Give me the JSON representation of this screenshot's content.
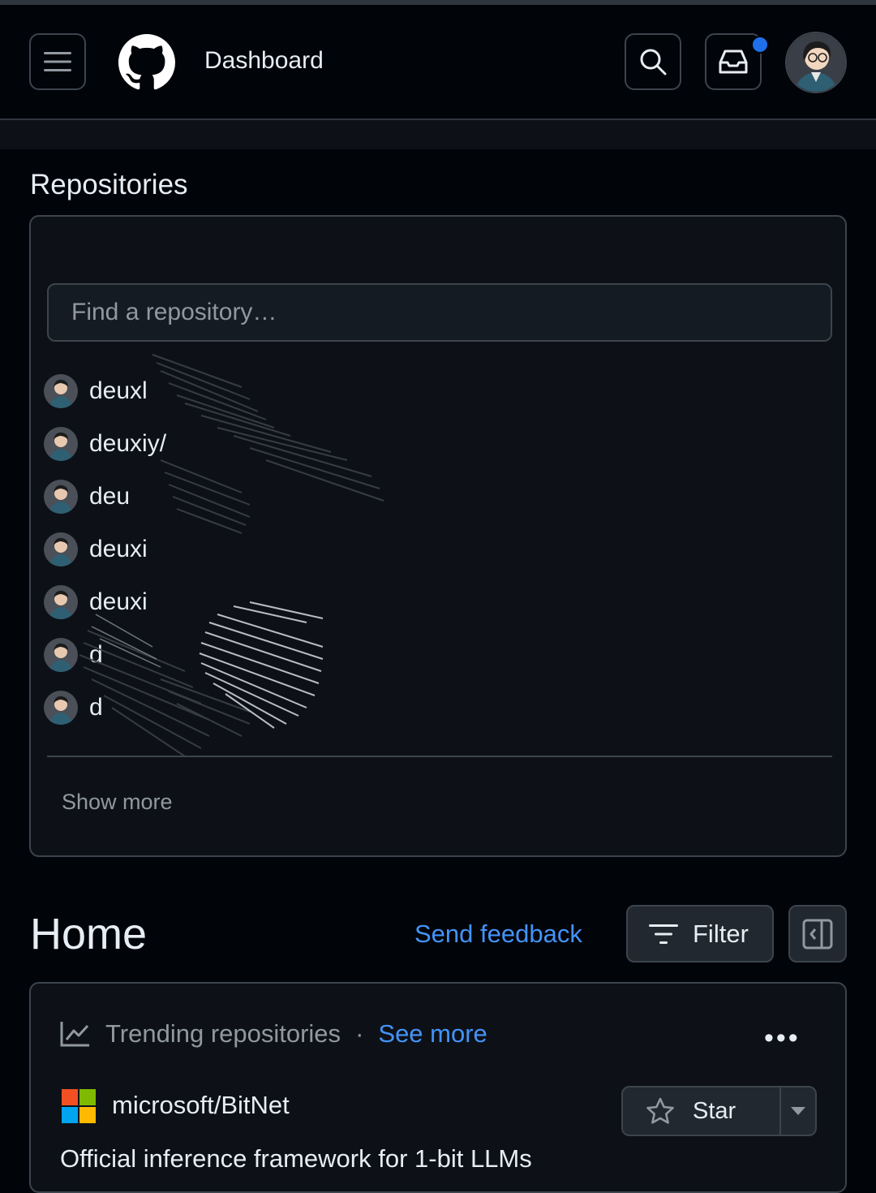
{
  "header": {
    "title": "Dashboard",
    "notification_dot_color": "#1f6feb",
    "icons": [
      "hamburger-icon",
      "github-logo",
      "search-icon",
      "inbox-icon",
      "avatar"
    ]
  },
  "repositories": {
    "heading": "Repositories",
    "search_placeholder": "Find a repository…",
    "items": [
      {
        "name": "deuxl"
      },
      {
        "name": "deuxiy/"
      },
      {
        "name": "deu"
      },
      {
        "name": "deuxi"
      },
      {
        "name": "deuxi"
      },
      {
        "name": "d"
      },
      {
        "name": "d"
      }
    ],
    "show_more": "Show more"
  },
  "home": {
    "title": "Home",
    "send_feedback": "Send feedback",
    "filter_label": "Filter"
  },
  "trending": {
    "label": "Trending repositories",
    "separator": "·",
    "see_more": "See more",
    "repo": {
      "full_name": "microsoft/BitNet",
      "description": "Official inference framework for 1-bit LLMs",
      "star_label": "Star"
    }
  },
  "colors": {
    "background": "#010409",
    "card": "#0d1117",
    "border": "#3d444d",
    "link": "#4493f8",
    "muted": "#9198a1"
  }
}
